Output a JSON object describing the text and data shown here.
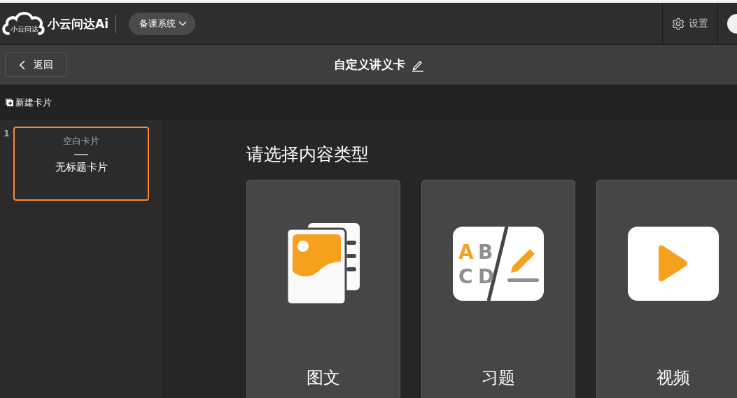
{
  "header": {
    "logo_text": "小云问达Ai",
    "logo_subtext": "小云问达",
    "system_menu": "备课系统",
    "settings": "设置"
  },
  "toolbar": {
    "back": "返回",
    "title": "自定义讲义卡"
  },
  "actions": {
    "new_card": "新建卡片"
  },
  "cards": [
    {
      "number": "1",
      "type": "空白卡片",
      "title": "无标题卡片",
      "selected": true
    }
  ],
  "content": {
    "heading": "请选择内容类型",
    "types": [
      {
        "kind": "image-text",
        "label": "图文"
      },
      {
        "kind": "exercise",
        "label": "习题",
        "letters": [
          "A",
          "B",
          "C",
          "D"
        ]
      },
      {
        "kind": "video",
        "label": "视频"
      }
    ]
  }
}
